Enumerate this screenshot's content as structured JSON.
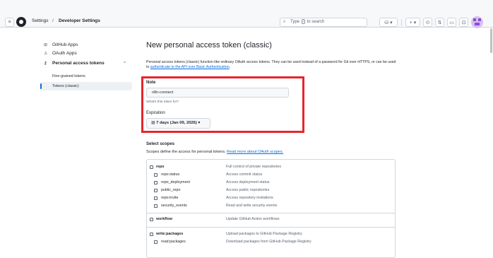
{
  "header": {
    "breadcrumb_root": "Settings",
    "breadcrumb_separator": "/",
    "breadcrumb_current": "Developer Settings",
    "search_prefix": "Type",
    "search_key": "/",
    "search_suffix": "to search"
  },
  "sidebar": {
    "items": [
      {
        "icon": "grid-icon",
        "glyph": "⊞",
        "label": "GitHub Apps"
      },
      {
        "icon": "person-icon",
        "glyph": "♙",
        "label": "OAuth Apps"
      },
      {
        "icon": "key-icon",
        "glyph": "⚷",
        "label": "Personal access tokens",
        "chevron": "^"
      },
      {
        "label": "Fine-grained tokens"
      },
      {
        "label": "Tokens (classic)"
      }
    ]
  },
  "main": {
    "title": "New personal access token (classic)",
    "desc_text": "Personal access tokens (classic) function like ordinary OAuth access tokens. They can be used instead of a password for Git over HTTPS, or can be used to",
    "desc_link": "authenticate to the API over Basic Authentication",
    "desc_end": ".",
    "note_label": "Note",
    "note_value": "n8n-connect",
    "note_hint": "What's this token for?",
    "expiration_label": "Expiration",
    "expiration_value": "7 days (Jan 09, 2026)",
    "select_scopes_label": "Select scopes",
    "scopes_desc": "Scopes define the access for personal tokens.",
    "scopes_link": "Read more about OAuth scopes."
  },
  "scopes": [
    {
      "name": "repo",
      "desc": "Full control of private repositories"
    },
    {
      "name": "repo:status",
      "desc": "Access commit status"
    },
    {
      "name": "repo_deployment",
      "desc": "Access deployment status"
    },
    {
      "name": "public_repo",
      "desc": "Access public repositories"
    },
    {
      "name": "repo:invite",
      "desc": "Access repository invitations"
    },
    {
      "name": "security_events",
      "desc": "Read and write security events"
    },
    {
      "name": "workflow",
      "desc": "Update GitHub Action workflows"
    },
    {
      "name": "write:packages",
      "desc": "Upload packages to GitHub Package Registry"
    },
    {
      "name": "read:packages",
      "desc": "Download packages from GitHub Package Registry"
    }
  ],
  "colors": {
    "highlight": "#e5262d",
    "link": "#0969da",
    "active_indicator": "#0969da"
  }
}
